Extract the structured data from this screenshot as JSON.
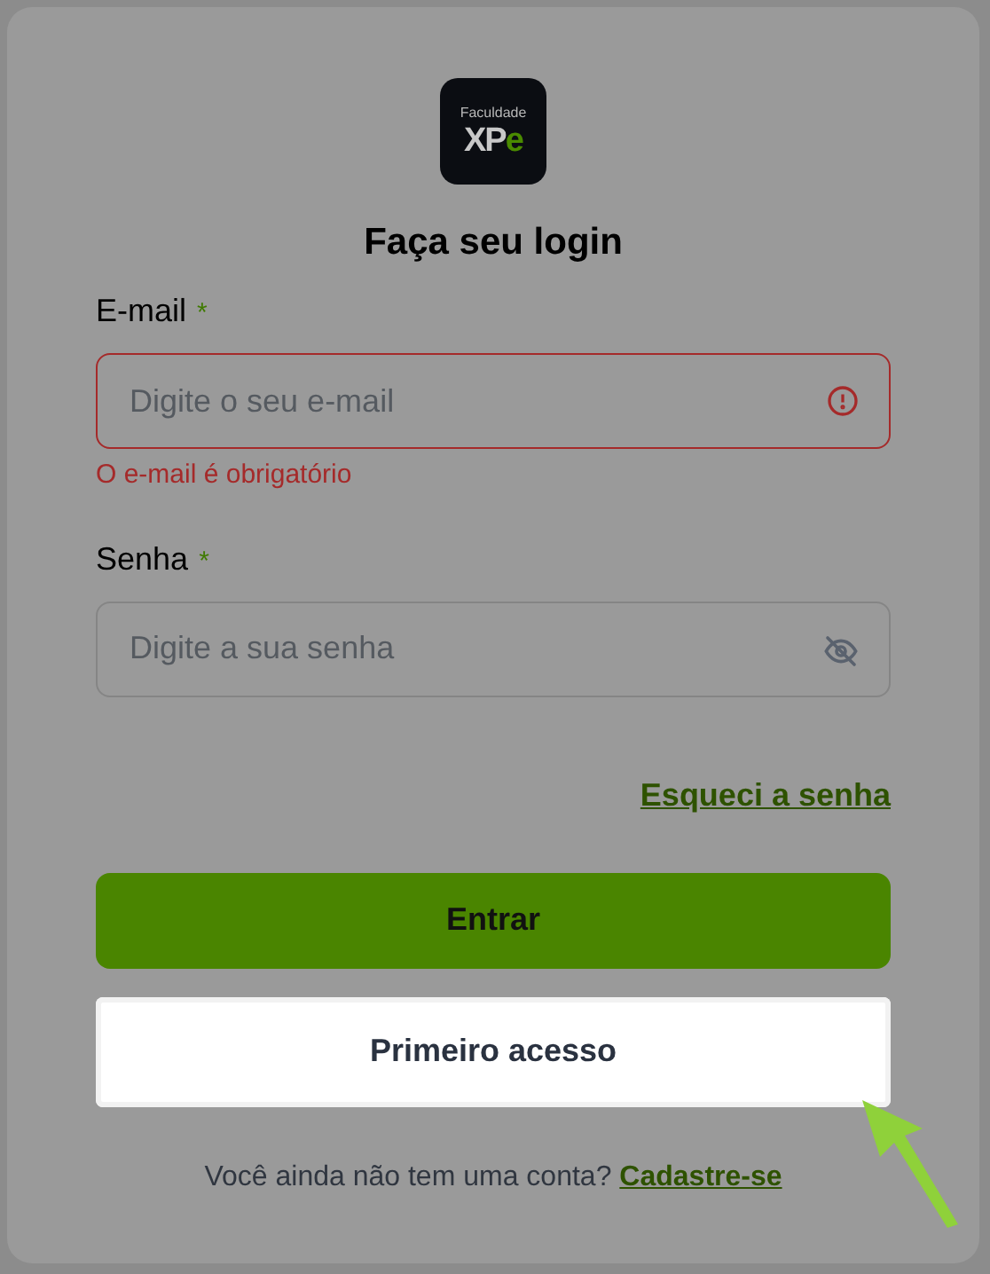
{
  "logo": {
    "caption": "Faculdade",
    "mark": "XP",
    "accent": "e"
  },
  "title": "Faça seu login",
  "fields": [
    {
      "label": "E-mail",
      "required_mark": "*",
      "placeholder": "Digite o seu e-mail",
      "kind": "email",
      "error": "O e-mail é obrigatório"
    },
    {
      "label": "Senha",
      "required_mark": "*",
      "placeholder": "Digite a sua senha",
      "kind": "password"
    }
  ],
  "forgot_link": "Esqueci a senha",
  "primary_button": "Entrar",
  "secondary_button": {
    "label": "Primeiro acesso",
    "highlighted": true
  },
  "signup": {
    "text": "Você ainda não tem uma conta?",
    "link": "Cadastre-se"
  }
}
